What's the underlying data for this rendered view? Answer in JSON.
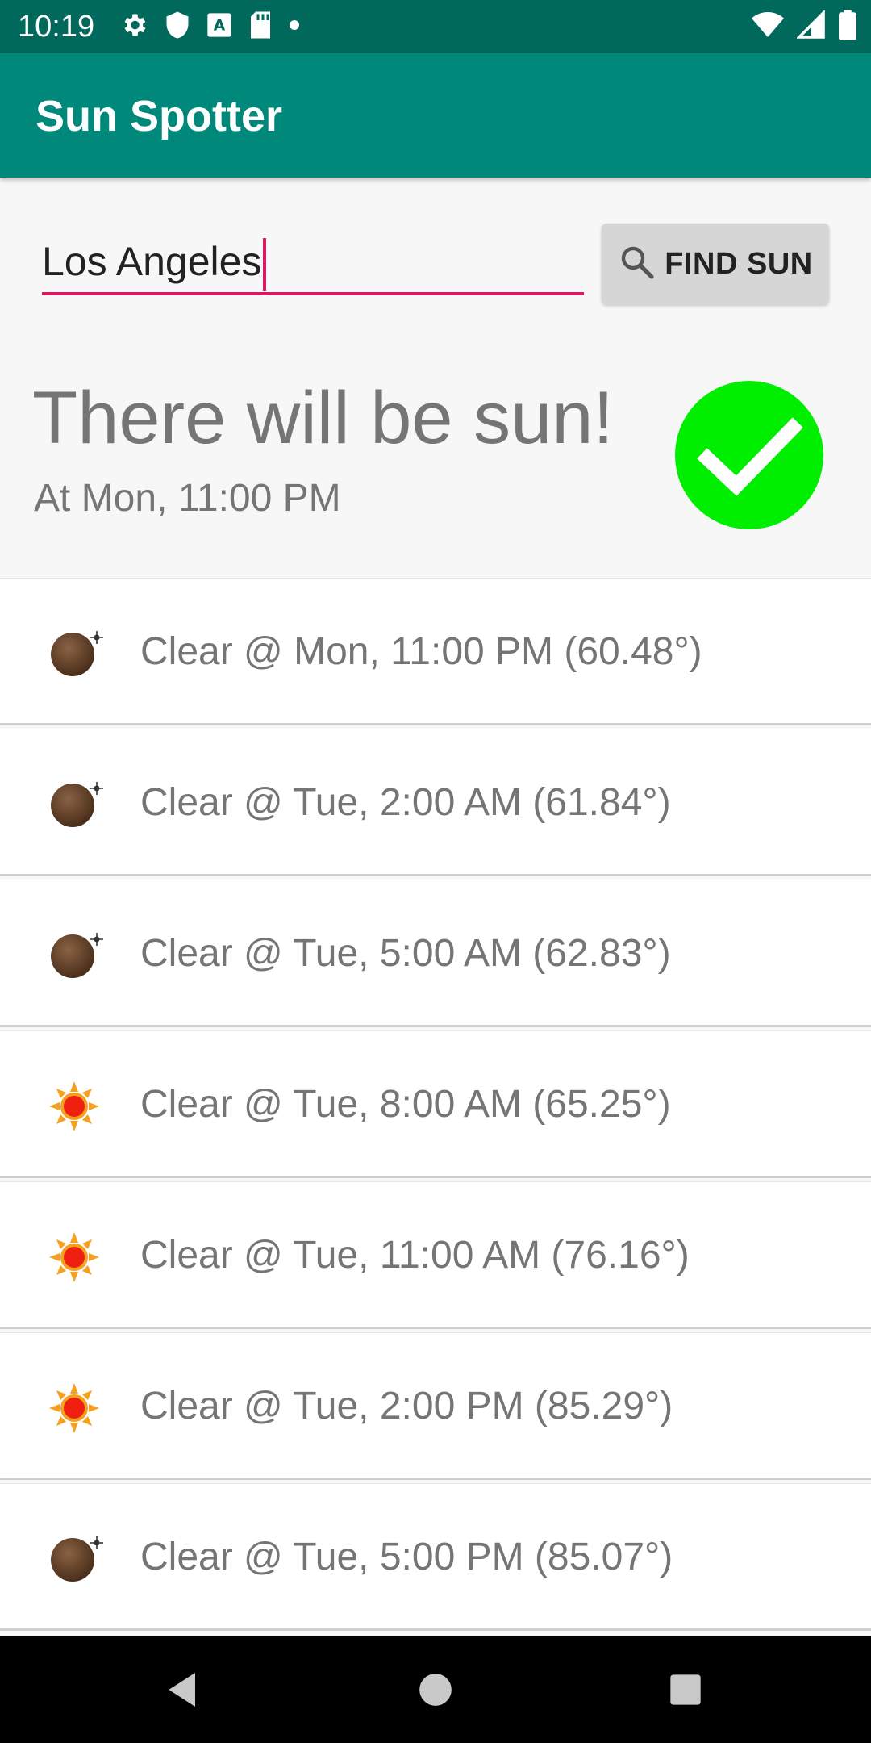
{
  "status_bar": {
    "time": "10:19",
    "left_icons": [
      "gear-icon",
      "shield-icon",
      "keyboard-a-icon",
      "sd-card-icon",
      "dot-icon"
    ],
    "right_icons": [
      "wifi-icon",
      "signal-icon",
      "battery-icon"
    ]
  },
  "app_bar": {
    "title": "Sun Spotter",
    "color": "#00897b"
  },
  "search": {
    "value": "Los Angeles",
    "button_label": "FIND SUN",
    "accent": "#d81b60"
  },
  "result": {
    "title": "There will be sun!",
    "subtitle": "At Mon, 11:00 PM",
    "status_icon": "check-circle-icon",
    "status_color": "#00ee00"
  },
  "forecast": [
    {
      "icon": "moon-icon",
      "text": "Clear @ Mon, 11:00 PM (60.48°)"
    },
    {
      "icon": "moon-icon",
      "text": "Clear @ Tue, 2:00 AM (61.84°)"
    },
    {
      "icon": "moon-icon",
      "text": "Clear @ Tue, 5:00 AM (62.83°)"
    },
    {
      "icon": "sun-icon",
      "text": "Clear @ Tue, 8:00 AM (65.25°)"
    },
    {
      "icon": "sun-icon",
      "text": "Clear @ Tue, 11:00 AM (76.16°)"
    },
    {
      "icon": "sun-icon",
      "text": "Clear @ Tue, 2:00 PM (85.29°)"
    },
    {
      "icon": "moon-icon",
      "text": "Clear @ Tue, 5:00 PM (85.07°)"
    }
  ],
  "nav_bar": {
    "buttons": [
      "back-icon",
      "home-icon",
      "recents-icon"
    ]
  }
}
